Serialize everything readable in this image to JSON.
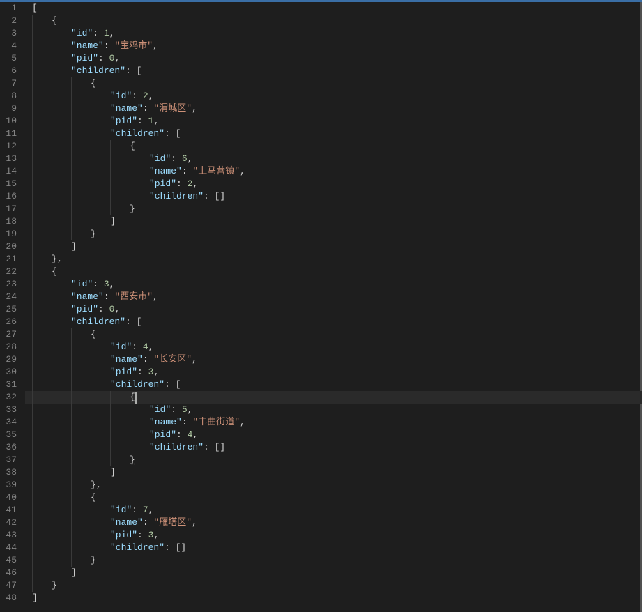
{
  "lines": [
    {
      "num": 1,
      "indent": 0,
      "guides": [],
      "tokens": [
        {
          "t": "p",
          "v": "["
        }
      ]
    },
    {
      "num": 2,
      "indent": 1,
      "guides": [
        0
      ],
      "tokens": [
        {
          "t": "p",
          "v": "{"
        }
      ]
    },
    {
      "num": 3,
      "indent": 2,
      "guides": [
        0,
        1
      ],
      "tokens": [
        {
          "t": "k",
          "v": "\"id\""
        },
        {
          "t": "c",
          "v": ": "
        },
        {
          "t": "n",
          "v": "1"
        },
        {
          "t": "c",
          "v": ","
        }
      ]
    },
    {
      "num": 4,
      "indent": 2,
      "guides": [
        0,
        1
      ],
      "tokens": [
        {
          "t": "k",
          "v": "\"name\""
        },
        {
          "t": "c",
          "v": ": "
        },
        {
          "t": "s",
          "v": "\"宝鸡市\""
        },
        {
          "t": "c",
          "v": ","
        }
      ]
    },
    {
      "num": 5,
      "indent": 2,
      "guides": [
        0,
        1
      ],
      "tokens": [
        {
          "t": "k",
          "v": "\"pid\""
        },
        {
          "t": "c",
          "v": ": "
        },
        {
          "t": "n",
          "v": "0"
        },
        {
          "t": "c",
          "v": ","
        }
      ]
    },
    {
      "num": 6,
      "indent": 2,
      "guides": [
        0,
        1
      ],
      "tokens": [
        {
          "t": "k",
          "v": "\"children\""
        },
        {
          "t": "c",
          "v": ": "
        },
        {
          "t": "p",
          "v": "["
        }
      ]
    },
    {
      "num": 7,
      "indent": 3,
      "guides": [
        0,
        1,
        2
      ],
      "tokens": [
        {
          "t": "p",
          "v": "{"
        }
      ]
    },
    {
      "num": 8,
      "indent": 4,
      "guides": [
        0,
        1,
        2,
        3
      ],
      "tokens": [
        {
          "t": "k",
          "v": "\"id\""
        },
        {
          "t": "c",
          "v": ": "
        },
        {
          "t": "n",
          "v": "2"
        },
        {
          "t": "c",
          "v": ","
        }
      ]
    },
    {
      "num": 9,
      "indent": 4,
      "guides": [
        0,
        1,
        2,
        3
      ],
      "tokens": [
        {
          "t": "k",
          "v": "\"name\""
        },
        {
          "t": "c",
          "v": ": "
        },
        {
          "t": "s",
          "v": "\"渭城区\""
        },
        {
          "t": "c",
          "v": ","
        }
      ]
    },
    {
      "num": 10,
      "indent": 4,
      "guides": [
        0,
        1,
        2,
        3
      ],
      "tokens": [
        {
          "t": "k",
          "v": "\"pid\""
        },
        {
          "t": "c",
          "v": ": "
        },
        {
          "t": "n",
          "v": "1"
        },
        {
          "t": "c",
          "v": ","
        }
      ]
    },
    {
      "num": 11,
      "indent": 4,
      "guides": [
        0,
        1,
        2,
        3
      ],
      "tokens": [
        {
          "t": "k",
          "v": "\"children\""
        },
        {
          "t": "c",
          "v": ": "
        },
        {
          "t": "p",
          "v": "["
        }
      ]
    },
    {
      "num": 12,
      "indent": 5,
      "guides": [
        0,
        1,
        2,
        3,
        4
      ],
      "tokens": [
        {
          "t": "p",
          "v": "{"
        }
      ]
    },
    {
      "num": 13,
      "indent": 6,
      "guides": [
        0,
        1,
        2,
        3,
        4,
        5
      ],
      "tokens": [
        {
          "t": "k",
          "v": "\"id\""
        },
        {
          "t": "c",
          "v": ": "
        },
        {
          "t": "n",
          "v": "6"
        },
        {
          "t": "c",
          "v": ","
        }
      ]
    },
    {
      "num": 14,
      "indent": 6,
      "guides": [
        0,
        1,
        2,
        3,
        4,
        5
      ],
      "tokens": [
        {
          "t": "k",
          "v": "\"name\""
        },
        {
          "t": "c",
          "v": ": "
        },
        {
          "t": "s",
          "v": "\"上马营镇\""
        },
        {
          "t": "c",
          "v": ","
        }
      ]
    },
    {
      "num": 15,
      "indent": 6,
      "guides": [
        0,
        1,
        2,
        3,
        4,
        5
      ],
      "tokens": [
        {
          "t": "k",
          "v": "\"pid\""
        },
        {
          "t": "c",
          "v": ": "
        },
        {
          "t": "n",
          "v": "2"
        },
        {
          "t": "c",
          "v": ","
        }
      ]
    },
    {
      "num": 16,
      "indent": 6,
      "guides": [
        0,
        1,
        2,
        3,
        4,
        5
      ],
      "tokens": [
        {
          "t": "k",
          "v": "\"children\""
        },
        {
          "t": "c",
          "v": ": "
        },
        {
          "t": "p",
          "v": "[]"
        }
      ]
    },
    {
      "num": 17,
      "indent": 5,
      "guides": [
        0,
        1,
        2,
        3,
        4
      ],
      "tokens": [
        {
          "t": "p",
          "v": "}"
        }
      ]
    },
    {
      "num": 18,
      "indent": 4,
      "guides": [
        0,
        1,
        2,
        3
      ],
      "tokens": [
        {
          "t": "p",
          "v": "]"
        }
      ]
    },
    {
      "num": 19,
      "indent": 3,
      "guides": [
        0,
        1,
        2
      ],
      "tokens": [
        {
          "t": "p",
          "v": "}"
        }
      ]
    },
    {
      "num": 20,
      "indent": 2,
      "guides": [
        0,
        1
      ],
      "tokens": [
        {
          "t": "p",
          "v": "]"
        }
      ]
    },
    {
      "num": 21,
      "indent": 1,
      "guides": [
        0
      ],
      "tokens": [
        {
          "t": "p",
          "v": "}"
        },
        {
          "t": "c",
          "v": ","
        }
      ]
    },
    {
      "num": 22,
      "indent": 1,
      "guides": [
        0
      ],
      "tokens": [
        {
          "t": "p",
          "v": "{"
        }
      ]
    },
    {
      "num": 23,
      "indent": 2,
      "guides": [
        0,
        1
      ],
      "tokens": [
        {
          "t": "k",
          "v": "\"id\""
        },
        {
          "t": "c",
          "v": ": "
        },
        {
          "t": "n",
          "v": "3"
        },
        {
          "t": "c",
          "v": ","
        }
      ]
    },
    {
      "num": 24,
      "indent": 2,
      "guides": [
        0,
        1
      ],
      "tokens": [
        {
          "t": "k",
          "v": "\"name\""
        },
        {
          "t": "c",
          "v": ": "
        },
        {
          "t": "s",
          "v": "\"西安市\""
        },
        {
          "t": "c",
          "v": ","
        }
      ]
    },
    {
      "num": 25,
      "indent": 2,
      "guides": [
        0,
        1
      ],
      "tokens": [
        {
          "t": "k",
          "v": "\"pid\""
        },
        {
          "t": "c",
          "v": ": "
        },
        {
          "t": "n",
          "v": "0"
        },
        {
          "t": "c",
          "v": ","
        }
      ]
    },
    {
      "num": 26,
      "indent": 2,
      "guides": [
        0,
        1
      ],
      "tokens": [
        {
          "t": "k",
          "v": "\"children\""
        },
        {
          "t": "c",
          "v": ": "
        },
        {
          "t": "p",
          "v": "["
        }
      ]
    },
    {
      "num": 27,
      "indent": 3,
      "guides": [
        0,
        1,
        2
      ],
      "tokens": [
        {
          "t": "p",
          "v": "{"
        }
      ]
    },
    {
      "num": 28,
      "indent": 4,
      "guides": [
        0,
        1,
        2,
        3
      ],
      "tokens": [
        {
          "t": "k",
          "v": "\"id\""
        },
        {
          "t": "c",
          "v": ": "
        },
        {
          "t": "n",
          "v": "4"
        },
        {
          "t": "c",
          "v": ","
        }
      ]
    },
    {
      "num": 29,
      "indent": 4,
      "guides": [
        0,
        1,
        2,
        3
      ],
      "tokens": [
        {
          "t": "k",
          "v": "\"name\""
        },
        {
          "t": "c",
          "v": ": "
        },
        {
          "t": "s",
          "v": "\"长安区\""
        },
        {
          "t": "c",
          "v": ","
        }
      ]
    },
    {
      "num": 30,
      "indent": 4,
      "guides": [
        0,
        1,
        2,
        3
      ],
      "tokens": [
        {
          "t": "k",
          "v": "\"pid\""
        },
        {
          "t": "c",
          "v": ": "
        },
        {
          "t": "n",
          "v": "3"
        },
        {
          "t": "c",
          "v": ","
        }
      ]
    },
    {
      "num": 31,
      "indent": 4,
      "guides": [
        0,
        1,
        2,
        3
      ],
      "tokens": [
        {
          "t": "k",
          "v": "\"children\""
        },
        {
          "t": "c",
          "v": ": "
        },
        {
          "t": "p",
          "v": "["
        }
      ]
    },
    {
      "num": 32,
      "indent": 5,
      "guides": [
        0,
        1,
        2,
        3,
        4
      ],
      "current": true,
      "tokens": [
        {
          "t": "p",
          "v": "{",
          "underline": true
        },
        {
          "t": "cursor"
        }
      ]
    },
    {
      "num": 33,
      "indent": 6,
      "guides": [
        0,
        1,
        2,
        3,
        4,
        5
      ],
      "tokens": [
        {
          "t": "k",
          "v": "\"id\""
        },
        {
          "t": "c",
          "v": ": "
        },
        {
          "t": "n",
          "v": "5"
        },
        {
          "t": "c",
          "v": ","
        }
      ]
    },
    {
      "num": 34,
      "indent": 6,
      "guides": [
        0,
        1,
        2,
        3,
        4,
        5
      ],
      "tokens": [
        {
          "t": "k",
          "v": "\"name\""
        },
        {
          "t": "c",
          "v": ": "
        },
        {
          "t": "s",
          "v": "\"韦曲街道\""
        },
        {
          "t": "c",
          "v": ","
        }
      ]
    },
    {
      "num": 35,
      "indent": 6,
      "guides": [
        0,
        1,
        2,
        3,
        4,
        5
      ],
      "tokens": [
        {
          "t": "k",
          "v": "\"pid\""
        },
        {
          "t": "c",
          "v": ": "
        },
        {
          "t": "n",
          "v": "4"
        },
        {
          "t": "c",
          "v": ","
        }
      ]
    },
    {
      "num": 36,
      "indent": 6,
      "guides": [
        0,
        1,
        2,
        3,
        4,
        5
      ],
      "tokens": [
        {
          "t": "k",
          "v": "\"children\""
        },
        {
          "t": "c",
          "v": ": "
        },
        {
          "t": "p",
          "v": "[]"
        }
      ]
    },
    {
      "num": 37,
      "indent": 5,
      "guides": [
        0,
        1,
        2,
        3,
        4
      ],
      "tokens": [
        {
          "t": "p",
          "v": "}",
          "underline": true
        }
      ]
    },
    {
      "num": 38,
      "indent": 4,
      "guides": [
        0,
        1,
        2,
        3
      ],
      "tokens": [
        {
          "t": "p",
          "v": "]"
        }
      ]
    },
    {
      "num": 39,
      "indent": 3,
      "guides": [
        0,
        1,
        2
      ],
      "tokens": [
        {
          "t": "p",
          "v": "}"
        },
        {
          "t": "c",
          "v": ","
        }
      ]
    },
    {
      "num": 40,
      "indent": 3,
      "guides": [
        0,
        1,
        2
      ],
      "tokens": [
        {
          "t": "p",
          "v": "{"
        }
      ]
    },
    {
      "num": 41,
      "indent": 4,
      "guides": [
        0,
        1,
        2,
        3
      ],
      "tokens": [
        {
          "t": "k",
          "v": "\"id\""
        },
        {
          "t": "c",
          "v": ": "
        },
        {
          "t": "n",
          "v": "7"
        },
        {
          "t": "c",
          "v": ","
        }
      ]
    },
    {
      "num": 42,
      "indent": 4,
      "guides": [
        0,
        1,
        2,
        3
      ],
      "tokens": [
        {
          "t": "k",
          "v": "\"name\""
        },
        {
          "t": "c",
          "v": ": "
        },
        {
          "t": "s",
          "v": "\"雁塔区\""
        },
        {
          "t": "c",
          "v": ","
        }
      ]
    },
    {
      "num": 43,
      "indent": 4,
      "guides": [
        0,
        1,
        2,
        3
      ],
      "tokens": [
        {
          "t": "k",
          "v": "\"pid\""
        },
        {
          "t": "c",
          "v": ": "
        },
        {
          "t": "n",
          "v": "3"
        },
        {
          "t": "c",
          "v": ","
        }
      ]
    },
    {
      "num": 44,
      "indent": 4,
      "guides": [
        0,
        1,
        2,
        3
      ],
      "tokens": [
        {
          "t": "k",
          "v": "\"children\""
        },
        {
          "t": "c",
          "v": ": "
        },
        {
          "t": "p",
          "v": "[]"
        }
      ]
    },
    {
      "num": 45,
      "indent": 3,
      "guides": [
        0,
        1,
        2
      ],
      "tokens": [
        {
          "t": "p",
          "v": "}"
        }
      ]
    },
    {
      "num": 46,
      "indent": 2,
      "guides": [
        0,
        1
      ],
      "tokens": [
        {
          "t": "p",
          "v": "]"
        }
      ]
    },
    {
      "num": 47,
      "indent": 1,
      "guides": [
        0
      ],
      "tokens": [
        {
          "t": "p",
          "v": "}"
        }
      ]
    },
    {
      "num": 48,
      "indent": 0,
      "guides": [],
      "tokens": [
        {
          "t": "p",
          "v": "]"
        }
      ]
    }
  ],
  "indentWidthPx": 28
}
